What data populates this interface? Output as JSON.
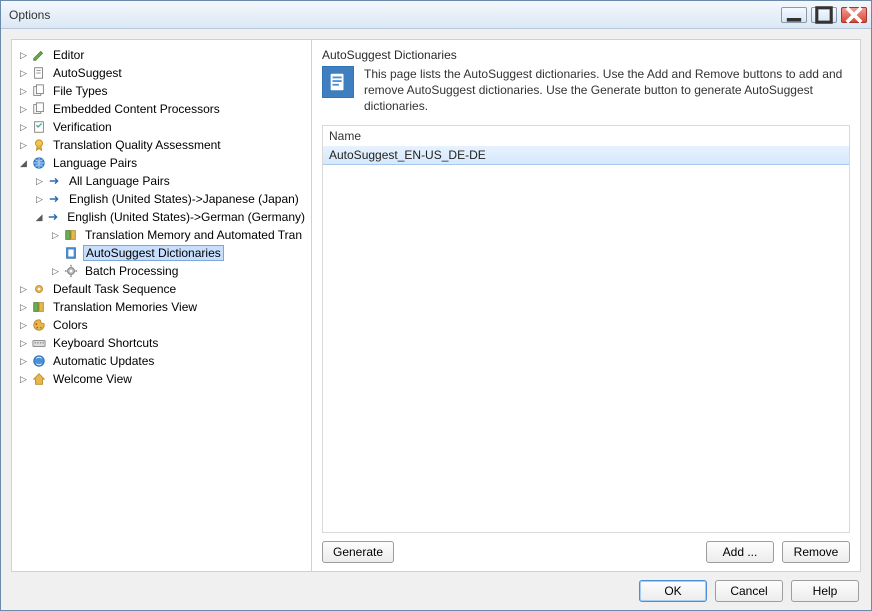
{
  "window": {
    "title": "Options"
  },
  "tree": {
    "editor": "Editor",
    "autosuggest": "AutoSuggest",
    "filetypes": "File Types",
    "embedded": "Embedded Content Processors",
    "verification": "Verification",
    "tqa": "Translation Quality Assessment",
    "langpairs": "Language Pairs",
    "all_pairs": "All Language Pairs",
    "en_ja": "English (United States)->Japanese (Japan)",
    "en_de": "English (United States)->German (Germany)",
    "tm_auto": "Translation Memory and Automated Tran",
    "as_dicts": "AutoSuggest Dictionaries",
    "batch": "Batch Processing",
    "default_task": "Default Task Sequence",
    "tm_view": "Translation Memories View",
    "colors": "Colors",
    "kbd": "Keyboard Shortcuts",
    "updates": "Automatic Updates",
    "welcome": "Welcome View"
  },
  "page": {
    "title": "AutoSuggest Dictionaries",
    "description": "This page lists the AutoSuggest dictionaries. Use the Add and Remove buttons to add and remove AutoSuggest dictionaries. Use the Generate button to generate AutoSuggest dictionaries.",
    "col_name": "Name",
    "row0": "AutoSuggest_EN-US_DE-DE"
  },
  "buttons": {
    "generate": "Generate",
    "add": "Add ...",
    "remove": "Remove",
    "ok": "OK",
    "cancel": "Cancel",
    "help": "Help"
  }
}
